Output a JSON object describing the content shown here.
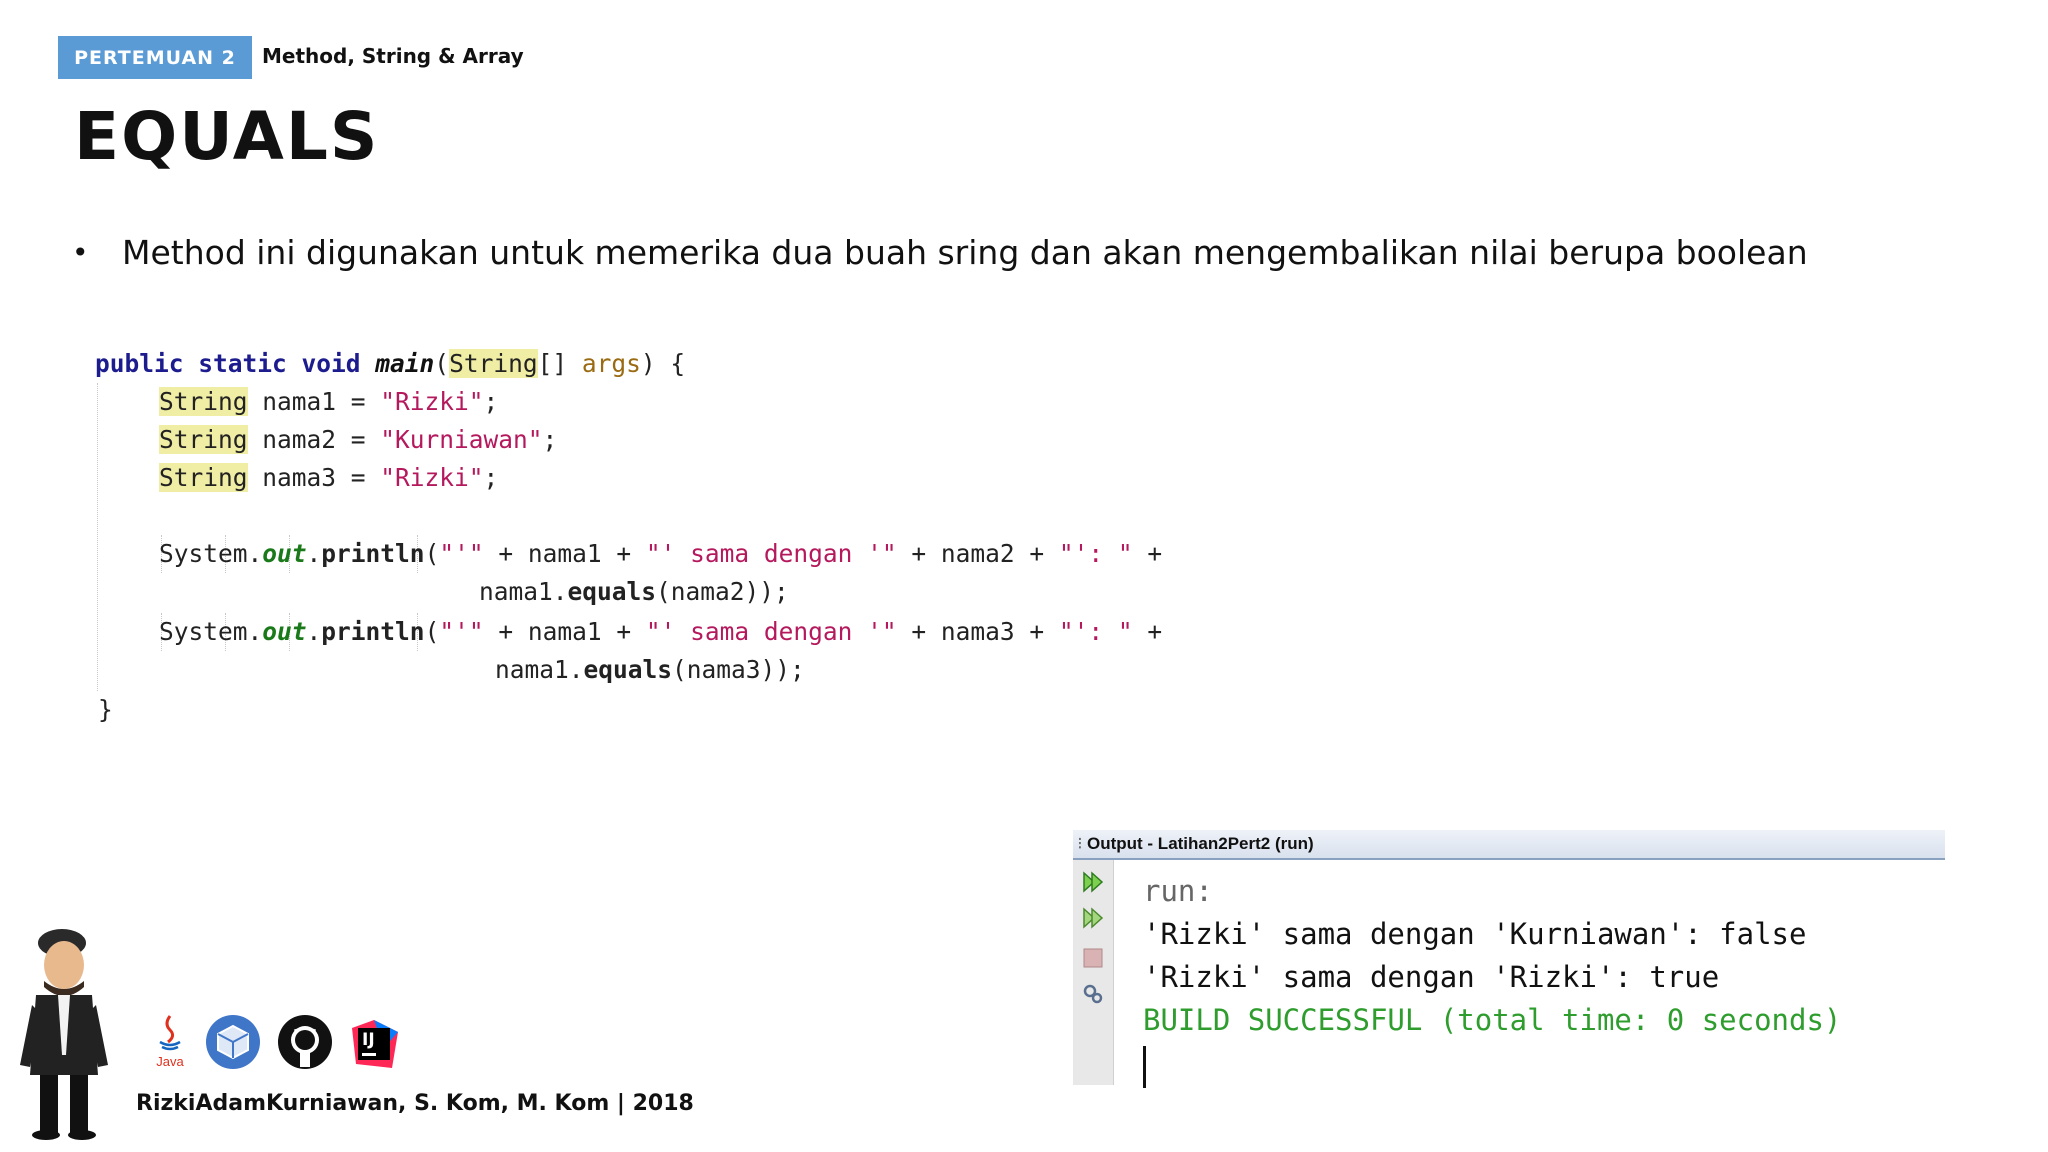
{
  "header": {
    "badge": "PERTEMUAN 2",
    "subtitle": "Method, String & Array",
    "title": "EQUALS"
  },
  "bullet": {
    "symbol": "•",
    "text": "Method ini digunakan untuk memerika dua buah sring dan akan mengembalikan nilai berupa boolean"
  },
  "code": {
    "l1": {
      "kw": "public static void",
      "method": "main",
      "open": "(",
      "type": "String",
      "mid": "[] ",
      "param": "args",
      "close": ") {"
    },
    "decls": [
      {
        "type": "String",
        "rest": " nama1 = ",
        "str": "\"Rizki\"",
        "end": ";"
      },
      {
        "type": "String",
        "rest": " nama2 = ",
        "str": "\"Kurniawan\"",
        "end": ";"
      },
      {
        "type": "String",
        "rest": " nama3 = ",
        "str": "\"Rizki\"",
        "end": ";"
      }
    ],
    "print1": {
      "sys": "System.",
      "out": "out",
      "dot": ".",
      "fn": "println",
      "a": "(",
      "s1": "\"'\"",
      "b": " + nama1 + ",
      "s2": "\"' sama dengan '\"",
      "c": " + nama2 + ",
      "s3": "\"': \"",
      "d": " +"
    },
    "print1b": {
      "obj": "nama1.",
      "fn": "equals",
      "args": "(nama2));"
    },
    "print2": {
      "sys": "System.",
      "out": "out",
      "dot": ".",
      "fn": "println",
      "a": "(",
      "s1": "\"'\"",
      "b": " + nama1 + ",
      "s2": "\"' sama dengan '\"",
      "c": " + nama3 + ",
      "s3": "\"': \"",
      "d": " +"
    },
    "print2b": {
      "obj": "nama1.",
      "fn": "equals",
      "args": "(nama3));"
    },
    "close": "}"
  },
  "output": {
    "title": "Output - Latihan2Pert2 (run)",
    "lines": [
      "run:",
      "'Rizki' sama dengan 'Kurniawan': false",
      "'Rizki' sama dengan 'Rizki': true",
      "BUILD SUCCESSFUL (total time: 0 seconds)"
    ]
  },
  "footer": {
    "author": "RizkiAdamKurniawan, S. Kom, M. Kom | 2018",
    "java_label": "Java",
    "ij_label": "IJ"
  },
  "colors": {
    "badge": "#5b9bd5",
    "keyword": "#1c1c8e",
    "string": "#b5195d",
    "highlight": "#f0eda4",
    "build_ok": "#2e9d2e"
  }
}
